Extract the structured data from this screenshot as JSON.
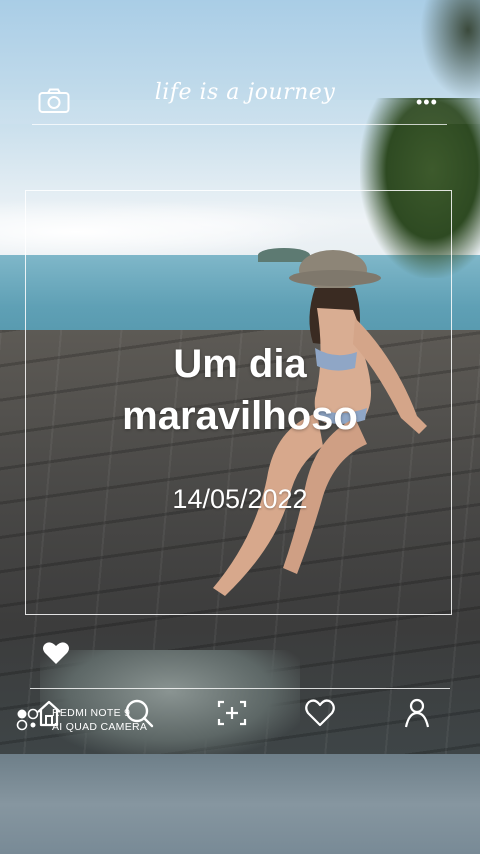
{
  "header": {
    "tagline": "life is a journey",
    "camera_icon": "camera-icon",
    "more_icon": "more-dots-icon",
    "more_label": "•••"
  },
  "overlay": {
    "title_line1": "Um dia",
    "title_line2": "maravilhoso",
    "date": "14/05/2022"
  },
  "actions": {
    "like_icon": "heart-filled-icon"
  },
  "bottom_nav": {
    "items": [
      {
        "icon": "home-icon"
      },
      {
        "icon": "search-icon"
      },
      {
        "icon": "add-photo-icon"
      },
      {
        "icon": "heart-icon"
      },
      {
        "icon": "profile-icon"
      }
    ]
  },
  "watermark": {
    "line1": "REDMI NOTE 9",
    "line2": "AI QUAD CAMERA"
  },
  "colors": {
    "overlay_text": "#ffffff",
    "frame": "#ffffff"
  }
}
